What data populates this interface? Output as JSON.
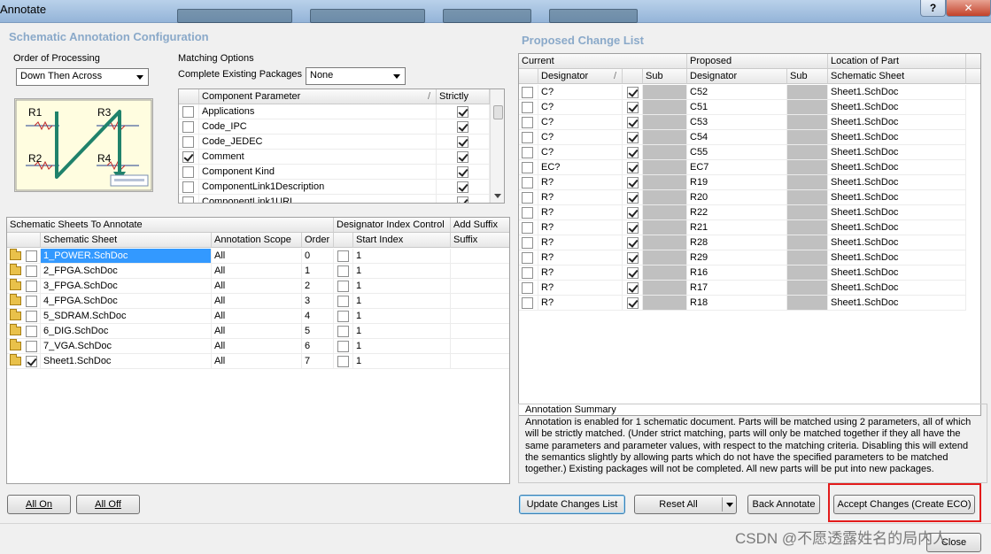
{
  "window": {
    "title": "Annotate"
  },
  "left": {
    "section_title": "Schematic Annotation Configuration",
    "order_group_label": "Order of Processing",
    "order_value": "Down Then Across",
    "diagram_labels": [
      "R1",
      "R3",
      "R2",
      "R4"
    ],
    "matching_group_label": "Matching Options",
    "complete_label": "Complete Existing Packages",
    "complete_value": "None",
    "param_headers": {
      "param": "Component Parameter",
      "strictly": "Strictly"
    },
    "params": [
      {
        "name": "Applications",
        "checked": false,
        "strict": true
      },
      {
        "name": "Code_IPC",
        "checked": false,
        "strict": true
      },
      {
        "name": "Code_JEDEC",
        "checked": false,
        "strict": true
      },
      {
        "name": "Comment",
        "checked": true,
        "strict": true
      },
      {
        "name": "Component Kind",
        "checked": false,
        "strict": true
      },
      {
        "name": "ComponentLink1Description",
        "checked": false,
        "strict": true
      },
      {
        "name": "ComponentLink1URL",
        "checked": false,
        "strict": true
      }
    ],
    "sheets_headers": {
      "group1": "Schematic Sheets To Annotate",
      "group2": "Designator Index Control",
      "group3": "Add Suffix",
      "sheet": "Schematic Sheet",
      "scope": "Annotation Scope",
      "order": "Order",
      "start": "Start Index",
      "suffix": "Suffix"
    },
    "sheets": [
      {
        "name": "1_POWER.SchDoc",
        "checked": false,
        "scope": "All",
        "order": "0",
        "start": "1",
        "selected": true
      },
      {
        "name": "2_FPGA.SchDoc",
        "checked": false,
        "scope": "All",
        "order": "1",
        "start": "1",
        "selected": false
      },
      {
        "name": "3_FPGA.SchDoc",
        "checked": false,
        "scope": "All",
        "order": "2",
        "start": "1",
        "selected": false
      },
      {
        "name": "4_FPGA.SchDoc",
        "checked": false,
        "scope": "All",
        "order": "3",
        "start": "1",
        "selected": false
      },
      {
        "name": "5_SDRAM.SchDoc",
        "checked": false,
        "scope": "All",
        "order": "4",
        "start": "1",
        "selected": false
      },
      {
        "name": "6_DIG.SchDoc",
        "checked": false,
        "scope": "All",
        "order": "5",
        "start": "1",
        "selected": false
      },
      {
        "name": "7_VGA.SchDoc",
        "checked": false,
        "scope": "All",
        "order": "6",
        "start": "1",
        "selected": false
      },
      {
        "name": "Sheet1.SchDoc",
        "checked": true,
        "scope": "All",
        "order": "7",
        "start": "1",
        "selected": false
      }
    ],
    "all_on": "All On",
    "all_off": "All Off"
  },
  "right": {
    "section_title": "Proposed Change List",
    "headers": {
      "current": "Current",
      "proposed": "Proposed",
      "location": "Location of Part",
      "designator": "Designator",
      "sub": "Sub",
      "proposed_designator": "Designator",
      "proposed_sub": "Sub",
      "schematic_sheet": "Schematic Sheet"
    },
    "changes": [
      {
        "current": "C?",
        "proposed": "C52",
        "sheet": "Sheet1.SchDoc"
      },
      {
        "current": "C?",
        "proposed": "C51",
        "sheet": "Sheet1.SchDoc"
      },
      {
        "current": "C?",
        "proposed": "C53",
        "sheet": "Sheet1.SchDoc"
      },
      {
        "current": "C?",
        "proposed": "C54",
        "sheet": "Sheet1.SchDoc"
      },
      {
        "current": "C?",
        "proposed": "C55",
        "sheet": "Sheet1.SchDoc"
      },
      {
        "current": "EC?",
        "proposed": "EC7",
        "sheet": "Sheet1.SchDoc"
      },
      {
        "current": "R?",
        "proposed": "R19",
        "sheet": "Sheet1.SchDoc"
      },
      {
        "current": "R?",
        "proposed": "R20",
        "sheet": "Sheet1.SchDoc"
      },
      {
        "current": "R?",
        "proposed": "R22",
        "sheet": "Sheet1.SchDoc"
      },
      {
        "current": "R?",
        "proposed": "R21",
        "sheet": "Sheet1.SchDoc"
      },
      {
        "current": "R?",
        "proposed": "R28",
        "sheet": "Sheet1.SchDoc"
      },
      {
        "current": "R?",
        "proposed": "R29",
        "sheet": "Sheet1.SchDoc"
      },
      {
        "current": "R?",
        "proposed": "R16",
        "sheet": "Sheet1.SchDoc"
      },
      {
        "current": "R?",
        "proposed": "R17",
        "sheet": "Sheet1.SchDoc"
      },
      {
        "current": "R?",
        "proposed": "R18",
        "sheet": "Sheet1.SchDoc"
      }
    ],
    "summary_label": "Annotation Summary",
    "summary_text": "Annotation is enabled for 1 schematic document. Parts will be matched using 2 parameters, all of which will be strictly matched. (Under strict matching, parts will only be matched together if they all have the same parameters and parameter values, with respect to the matching criteria. Disabling this will extend the semantics slightly by allowing parts which do not have the specified parameters to be matched together.) Existing packages will not be completed. All new parts will be put into new packages.",
    "update_btn": "Update Changes List",
    "reset_btn": "Reset All",
    "back_btn": "Back Annotate",
    "accept_btn": "Accept Changes (Create ECO)",
    "close_btn": "Close"
  },
  "watermark": "CSDN @不愿透露姓名的局内人",
  "colors": {
    "selection": "#3399ff",
    "highlight_box": "#e31b1b",
    "section_title": "#8aa9c9"
  }
}
